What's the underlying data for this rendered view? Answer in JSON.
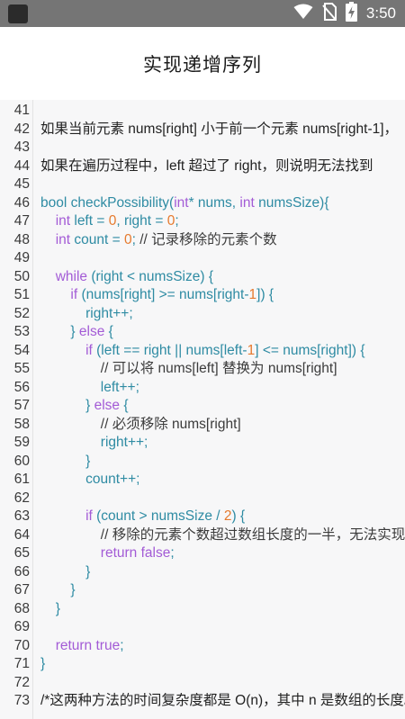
{
  "statusbar": {
    "time": "3:50",
    "icons": [
      "app-icon",
      "wifi-icon",
      "no-sim-icon",
      "battery-charging-icon"
    ]
  },
  "header": {
    "title": "实现递增序列"
  },
  "code": {
    "lines": [
      {
        "n": "41",
        "indent": 0,
        "tokens": []
      },
      {
        "n": "42",
        "indent": 0,
        "tokens": [
          {
            "c": "t-dark",
            "t": "如果当前元素 nums[right] 小于前一个元素 nums[right-1]，"
          }
        ]
      },
      {
        "n": "43",
        "indent": 0,
        "tokens": []
      },
      {
        "n": "44",
        "indent": 0,
        "tokens": [
          {
            "c": "t-dark",
            "t": "如果在遍历过程中，left 超过了 right，则说明无法找到"
          }
        ]
      },
      {
        "n": "45",
        "indent": 0,
        "tokens": []
      },
      {
        "n": "46",
        "indent": 0,
        "tokens": [
          {
            "c": "t-plain",
            "t": "bool checkPossibility("
          },
          {
            "c": "t-kw",
            "t": "int"
          },
          {
            "c": "t-plain",
            "t": "* nums, "
          },
          {
            "c": "t-kw",
            "t": "int"
          },
          {
            "c": "t-plain",
            "t": " numsSize){"
          }
        ]
      },
      {
        "n": "47",
        "indent": 1,
        "tokens": [
          {
            "c": "t-kw",
            "t": "int"
          },
          {
            "c": "t-plain",
            "t": " left = "
          },
          {
            "c": "t-num",
            "t": "0"
          },
          {
            "c": "t-plain",
            "t": ", right = "
          },
          {
            "c": "t-num",
            "t": "0"
          },
          {
            "c": "t-plain",
            "t": ";"
          }
        ]
      },
      {
        "n": "48",
        "indent": 1,
        "tokens": [
          {
            "c": "t-kw",
            "t": "int"
          },
          {
            "c": "t-plain",
            "t": " count = "
          },
          {
            "c": "t-num",
            "t": "0"
          },
          {
            "c": "t-plain",
            "t": "; "
          },
          {
            "c": "t-cmt",
            "t": "// 记录移除的元素个数"
          }
        ]
      },
      {
        "n": "49",
        "indent": 0,
        "tokens": []
      },
      {
        "n": "50",
        "indent": 1,
        "tokens": [
          {
            "c": "t-kw",
            "t": "while"
          },
          {
            "c": "t-plain",
            "t": " (right < numsSize) {"
          }
        ]
      },
      {
        "n": "51",
        "indent": 2,
        "tokens": [
          {
            "c": "t-kw",
            "t": "if"
          },
          {
            "c": "t-plain",
            "t": " (nums[right] >= nums[right-"
          },
          {
            "c": "t-num",
            "t": "1"
          },
          {
            "c": "t-plain",
            "t": "]) {"
          }
        ]
      },
      {
        "n": "52",
        "indent": 3,
        "tokens": [
          {
            "c": "t-plain",
            "t": "right++;"
          }
        ]
      },
      {
        "n": "53",
        "indent": 2,
        "tokens": [
          {
            "c": "t-plain",
            "t": "} "
          },
          {
            "c": "t-kw",
            "t": "else"
          },
          {
            "c": "t-plain",
            "t": " {"
          }
        ]
      },
      {
        "n": "54",
        "indent": 3,
        "tokens": [
          {
            "c": "t-kw",
            "t": "if"
          },
          {
            "c": "t-plain",
            "t": " (left == right || nums[left-"
          },
          {
            "c": "t-num",
            "t": "1"
          },
          {
            "c": "t-plain",
            "t": "] <= nums[right]) {"
          }
        ]
      },
      {
        "n": "55",
        "indent": 4,
        "tokens": [
          {
            "c": "t-cmt",
            "t": "// 可以将 nums[left] 替换为 nums[right]"
          }
        ]
      },
      {
        "n": "56",
        "indent": 4,
        "tokens": [
          {
            "c": "t-plain",
            "t": "left++;"
          }
        ]
      },
      {
        "n": "57",
        "indent": 3,
        "tokens": [
          {
            "c": "t-plain",
            "t": "} "
          },
          {
            "c": "t-kw",
            "t": "else"
          },
          {
            "c": "t-plain",
            "t": " {"
          }
        ]
      },
      {
        "n": "58",
        "indent": 4,
        "tokens": [
          {
            "c": "t-cmt",
            "t": "// 必须移除 nums[right]"
          }
        ]
      },
      {
        "n": "59",
        "indent": 4,
        "tokens": [
          {
            "c": "t-plain",
            "t": "right++;"
          }
        ]
      },
      {
        "n": "60",
        "indent": 3,
        "tokens": [
          {
            "c": "t-plain",
            "t": "}"
          }
        ]
      },
      {
        "n": "61",
        "indent": 3,
        "tokens": [
          {
            "c": "t-plain",
            "t": "count++;"
          }
        ]
      },
      {
        "n": "62",
        "indent": 0,
        "tokens": []
      },
      {
        "n": "63",
        "indent": 3,
        "tokens": [
          {
            "c": "t-kw",
            "t": "if"
          },
          {
            "c": "t-plain",
            "t": " (count > numsSize / "
          },
          {
            "c": "t-num",
            "t": "2"
          },
          {
            "c": "t-plain",
            "t": ") {"
          }
        ]
      },
      {
        "n": "64",
        "indent": 4,
        "tokens": [
          {
            "c": "t-cmt",
            "t": "// 移除的元素个数超过数组长度的一半，无法实现"
          }
        ]
      },
      {
        "n": "65",
        "indent": 4,
        "tokens": [
          {
            "c": "t-kw",
            "t": "return"
          },
          {
            "c": "t-plain",
            "t": " "
          },
          {
            "c": "t-kw",
            "t": "false"
          },
          {
            "c": "t-plain",
            "t": ";"
          }
        ]
      },
      {
        "n": "66",
        "indent": 3,
        "tokens": [
          {
            "c": "t-plain",
            "t": "}"
          }
        ]
      },
      {
        "n": "67",
        "indent": 2,
        "tokens": [
          {
            "c": "t-plain",
            "t": "}"
          }
        ]
      },
      {
        "n": "68",
        "indent": 1,
        "tokens": [
          {
            "c": "t-plain",
            "t": "}"
          }
        ]
      },
      {
        "n": "69",
        "indent": 0,
        "tokens": []
      },
      {
        "n": "70",
        "indent": 1,
        "tokens": [
          {
            "c": "t-kw",
            "t": "return"
          },
          {
            "c": "t-plain",
            "t": " "
          },
          {
            "c": "t-kw",
            "t": "true"
          },
          {
            "c": "t-plain",
            "t": ";"
          }
        ]
      },
      {
        "n": "71",
        "indent": 0,
        "tokens": [
          {
            "c": "t-plain",
            "t": "}"
          }
        ]
      },
      {
        "n": "72",
        "indent": 0,
        "tokens": []
      },
      {
        "n": "73",
        "indent": 0,
        "tokens": [
          {
            "c": "t-dark",
            "t": "/*这两种方法的时间复杂度都是 O(n)，其中 n 是数组的长度。"
          }
        ]
      }
    ]
  }
}
